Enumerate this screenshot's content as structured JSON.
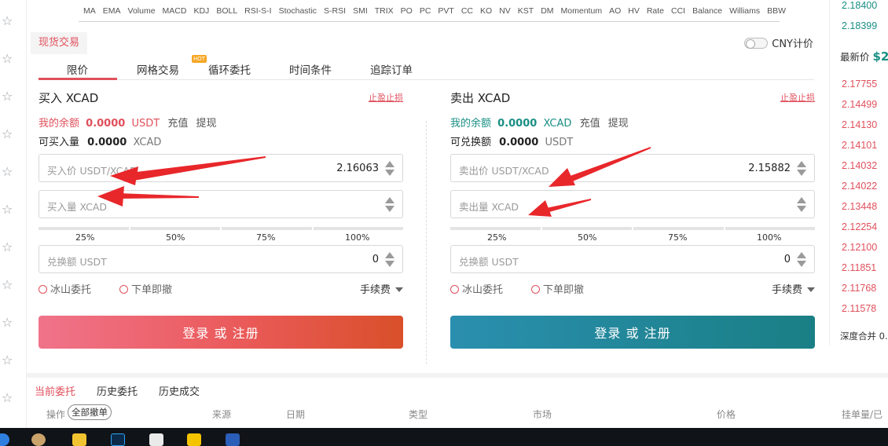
{
  "indicators": [
    "MA",
    "EMA",
    "Volume",
    "MACD",
    "KDJ",
    "BOLL",
    "RSI-S-I",
    "Stochastic",
    "S-RSI",
    "SMI",
    "TRIX",
    "PO",
    "PC",
    "PVT",
    "CC",
    "KO",
    "NV",
    "KST",
    "DM",
    "Momentum",
    "AO",
    "HV",
    "Rate",
    "CCI",
    "Balance",
    "Williams",
    "BBW"
  ],
  "panel": {
    "spot_tab": "现货交易",
    "cny_label": "CNY计价"
  },
  "order_tabs": [
    "限价",
    "网格交易",
    "循环委托",
    "时间条件",
    "追踪订单"
  ],
  "hot_badge": "HOT",
  "buy": {
    "title": "买入 XCAD",
    "stoploss": "止盈止损",
    "balance_label": "我的余额",
    "balance_value": "0.0000",
    "balance_unit": "USDT",
    "deposit": "充值",
    "withdraw": "提现",
    "avail_label": "可买入量",
    "avail_value": "0.0000",
    "avail_unit": "XCAD",
    "price_placeholder": "买入价 USDT/XCAD",
    "price_value": "2.16063",
    "amount_placeholder": "买入量 XCAD",
    "total_placeholder": "兑换额 USDT",
    "total_value": "0",
    "button": "登录 或 注册"
  },
  "sell": {
    "title": "卖出 XCAD",
    "stoploss": "止盈止损",
    "balance_label": "我的余额",
    "balance_value": "0.0000",
    "balance_unit": "XCAD",
    "deposit": "充值",
    "withdraw": "提现",
    "avail_label": "可兑换额",
    "avail_value": "0.0000",
    "avail_unit": "USDT",
    "price_placeholder": "卖出价 USDT/XCAD",
    "price_value": "2.15882",
    "amount_placeholder": "卖出量 XCAD",
    "total_placeholder": "兑换额 USDT",
    "total_value": "0",
    "button": "登录 或 注册"
  },
  "percent_labels": [
    "25%",
    "50%",
    "75%",
    "100%"
  ],
  "options": {
    "iceberg": "冰山委托",
    "ioc": "下单即撤",
    "fee": "手续费"
  },
  "orderbook": {
    "top_prices": [
      "2.18400",
      "2.18399"
    ],
    "latest_label": "最新价",
    "latest_value": "$2",
    "asks": [
      "2.17755",
      "2.14499",
      "2.14130",
      "2.14101",
      "2.14032",
      "2.14022",
      "2.13448",
      "2.12254",
      "2.12100",
      "2.11851",
      "2.11768",
      "2.11578"
    ],
    "depth_label": "深度合并 0."
  },
  "bottom": {
    "tabs": [
      "当前委托",
      "历史委托",
      "历史成交"
    ],
    "cancel_all": "全部撤单",
    "columns": [
      "操作",
      "来源",
      "日期",
      "类型",
      "市场",
      "价格",
      "挂单量/已"
    ]
  },
  "colors": {
    "accent_red": "#e0505c",
    "accent_teal": "#1a8f84",
    "arrow_red": "#e8272b"
  }
}
